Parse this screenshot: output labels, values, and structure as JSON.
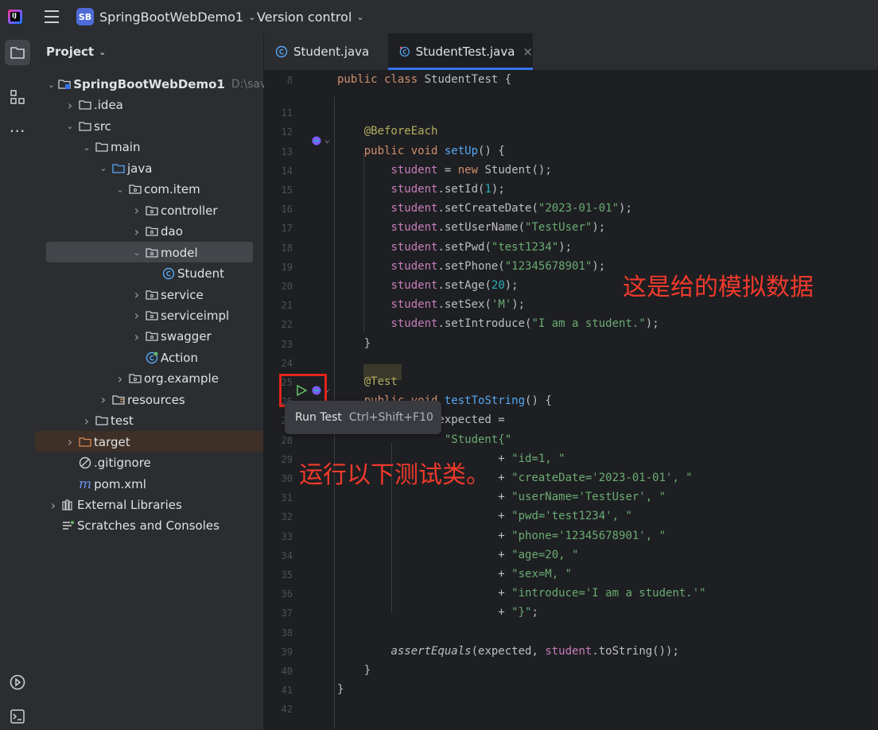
{
  "titlebar": {
    "project_badge": "SB",
    "project_name": "SpringBootWebDemo1",
    "vcs": "Version control"
  },
  "panel": {
    "title": "Project",
    "tree": [
      {
        "label": "SpringBootWebDemo1",
        "extra": "D:\\save\\",
        "indent": 0,
        "arrow": "down",
        "icon": "module-folder-icon",
        "bold": true
      },
      {
        "label": ".idea",
        "indent": 1,
        "arrow": "right",
        "icon": "folder-icon"
      },
      {
        "label": "src",
        "indent": 1,
        "arrow": "down",
        "icon": "folder-icon"
      },
      {
        "label": "main",
        "indent": 2,
        "arrow": "down",
        "icon": "folder-icon"
      },
      {
        "label": "java",
        "indent": 3,
        "arrow": "down",
        "icon": "source-folder-icon"
      },
      {
        "label": "com.item",
        "indent": 4,
        "arrow": "down",
        "icon": "package-icon"
      },
      {
        "label": "controller",
        "indent": 5,
        "arrow": "right",
        "icon": "package-icon"
      },
      {
        "label": "dao",
        "indent": 5,
        "arrow": "right",
        "icon": "package-icon"
      },
      {
        "label": "model",
        "indent": 5,
        "arrow": "down",
        "icon": "package-icon"
      },
      {
        "label": "Student",
        "indent": 6,
        "arrow": "",
        "icon": "class-icon"
      },
      {
        "label": "service",
        "indent": 5,
        "arrow": "right",
        "icon": "package-icon"
      },
      {
        "label": "serviceimpl",
        "indent": 5,
        "arrow": "right",
        "icon": "package-icon"
      },
      {
        "label": "swagger",
        "indent": 5,
        "arrow": "right",
        "icon": "package-icon"
      },
      {
        "label": "Action",
        "indent": 5,
        "arrow": "",
        "icon": "spring-class-icon"
      },
      {
        "label": "org.example",
        "indent": 4,
        "arrow": "right",
        "icon": "package-icon"
      },
      {
        "label": "resources",
        "indent": 3,
        "arrow": "right",
        "icon": "resources-folder-icon"
      },
      {
        "label": "test",
        "indent": 2,
        "arrow": "right",
        "icon": "folder-icon"
      },
      {
        "label": "target",
        "indent": 1,
        "arrow": "right",
        "icon": "excluded-folder-icon"
      },
      {
        "label": ".gitignore",
        "indent": 1,
        "arrow": "",
        "icon": "ignore-file-icon"
      },
      {
        "label": "pom.xml",
        "indent": 1,
        "arrow": "",
        "icon": "maven-icon"
      },
      {
        "label": "External Libraries",
        "indent": 0,
        "arrow": "right",
        "icon": "library-icon"
      },
      {
        "label": "Scratches and Consoles",
        "indent": 0,
        "arrow": "",
        "icon": "scratches-icon"
      }
    ]
  },
  "tabs": [
    {
      "label": "Student.java",
      "close": ""
    },
    {
      "label": "StudentTest.java",
      "close": "×"
    }
  ],
  "code": {
    "lines": [
      {
        "n": "8",
        "html": "<span class='kw'>public class</span> StudentTest {"
      },
      {
        "n": "11",
        "html": ""
      },
      {
        "n": "12",
        "html": "    <span class='ann'>@BeforeEach</span>"
      },
      {
        "n": "13",
        "html": "    <span class='kw'>public void</span> <span class='fn'>setUp</span>() {"
      },
      {
        "n": "14",
        "html": "        <span class='fld'>student</span> = <span class='kw'>new</span> Student();"
      },
      {
        "n": "15",
        "html": "        <span class='fld'>student</span>.setId(<span class='num'>1</span>);"
      },
      {
        "n": "16",
        "html": "        <span class='fld'>student</span>.setCreateDate(<span class='str'>\"2023-01-01\"</span>);"
      },
      {
        "n": "17",
        "html": "        <span class='fld'>student</span>.setUserName(<span class='str'>\"TestUser\"</span>);"
      },
      {
        "n": "18",
        "html": "        <span class='fld'>student</span>.setPwd(<span class='str'>\"test1234\"</span>);"
      },
      {
        "n": "19",
        "html": "        <span class='fld'>student</span>.setPhone(<span class='str'>\"12345678901\"</span>);"
      },
      {
        "n": "20",
        "html": "        <span class='fld'>student</span>.setAge(<span class='num'>20</span>);"
      },
      {
        "n": "21",
        "html": "        <span class='fld'>student</span>.setSex(<span class='str'>'M'</span>);"
      },
      {
        "n": "22",
        "html": "        <span class='fld'>student</span>.setIntroduce(<span class='str'>\"I am a student.\"</span>);"
      },
      {
        "n": "23",
        "html": "    }"
      },
      {
        "n": "24",
        "html": ""
      },
      {
        "n": "25",
        "html": "    <span class='ann'>@Test</span>"
      },
      {
        "n": "26",
        "html": "    <span class='kw'>public void</span> <span class='fn'>testToString</span>() {"
      },
      {
        "n": "27",
        "html": "        String expected ="
      },
      {
        "n": "28",
        "html": "                <span class='str'>\"Student{\"</span>"
      },
      {
        "n": "29",
        "html": "                        + <span class='str'>\"id=1, \"</span>"
      },
      {
        "n": "30",
        "html": "                        + <span class='str'>\"createDate='2023-01-01', \"</span>"
      },
      {
        "n": "31",
        "html": "                        + <span class='str'>\"userName='TestUser', \"</span>"
      },
      {
        "n": "32",
        "html": "                        + <span class='str'>\"pwd='test1234', \"</span>"
      },
      {
        "n": "33",
        "html": "                        + <span class='str'>\"phone='12345678901', \"</span>"
      },
      {
        "n": "34",
        "html": "                        + <span class='str'>\"age=20, \"</span>"
      },
      {
        "n": "35",
        "html": "                        + <span class='str'>\"sex=M, \"</span>"
      },
      {
        "n": "36",
        "html": "                        + <span class='str'>\"introduce='I am a student.'\"</span>"
      },
      {
        "n": "37",
        "html": "                        + <span class='str'>\"}\"</span>;"
      },
      {
        "n": "38",
        "html": ""
      },
      {
        "n": "39",
        "html": "        <span class='it'>assertEquals</span>(expected, <span class='fld'>student</span>.toString());"
      },
      {
        "n": "40",
        "html": "    }"
      },
      {
        "n": "41",
        "html": "}"
      },
      {
        "n": "42",
        "html": ""
      }
    ]
  },
  "tooltip": {
    "label": "Run Test",
    "shortcut": "Ctrl+Shift+F10"
  },
  "annotations": {
    "note1": "这是给的模拟数据",
    "note2": "运行以下测试类。"
  },
  "colors": {
    "accent": "#3574f0",
    "annotation_red": "#e3251c"
  }
}
